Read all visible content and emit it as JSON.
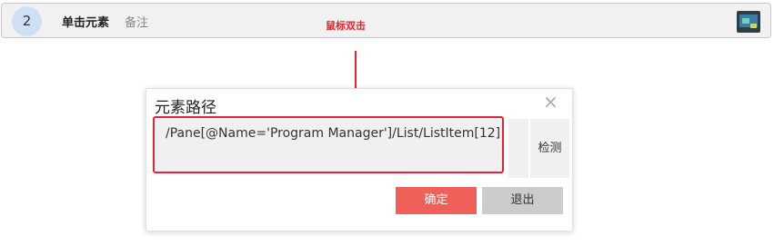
{
  "step": {
    "number": "2",
    "title": "单击元素",
    "note": "备注",
    "thumbnail_icon": "app-thumbnail-icon"
  },
  "annotation": {
    "text": "鼠标双击",
    "color": "#e8242e"
  },
  "dialog": {
    "title": "元素路径",
    "close_label": "×",
    "path_value": "/Pane[@Name='Program Manager']/List/ListItem[12]",
    "detect_label": "检测",
    "ok_label": "确定",
    "cancel_label": "退出"
  },
  "colors": {
    "accent_red": "#e2243b",
    "ok_button": "#f0605a",
    "cancel_button": "#cccccc",
    "step_badge": "#cfe0f5"
  }
}
